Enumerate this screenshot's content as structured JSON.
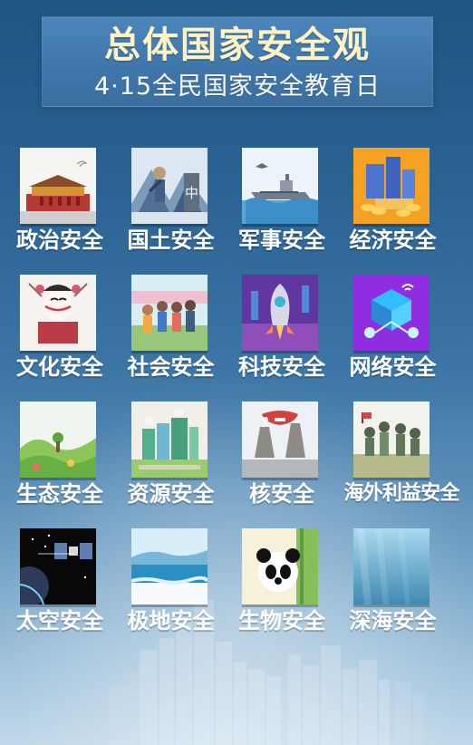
{
  "header": {
    "title": "总体国家安全观",
    "subtitle": "4·15全民国家安全教育日"
  },
  "grid": {
    "items": [
      {
        "label": "政治安全"
      },
      {
        "label": "国土安全"
      },
      {
        "label": "军事安全"
      },
      {
        "label": "经济安全"
      },
      {
        "label": "文化安全"
      },
      {
        "label": "社会安全"
      },
      {
        "label": "科技安全"
      },
      {
        "label": "网络安全"
      },
      {
        "label": "生态安全"
      },
      {
        "label": "资源安全"
      },
      {
        "label": "核安全"
      },
      {
        "label": "海外利益安全"
      },
      {
        "label": "太空安全"
      },
      {
        "label": "极地安全"
      },
      {
        "label": "生物安全"
      },
      {
        "label": "深海安全"
      }
    ]
  }
}
